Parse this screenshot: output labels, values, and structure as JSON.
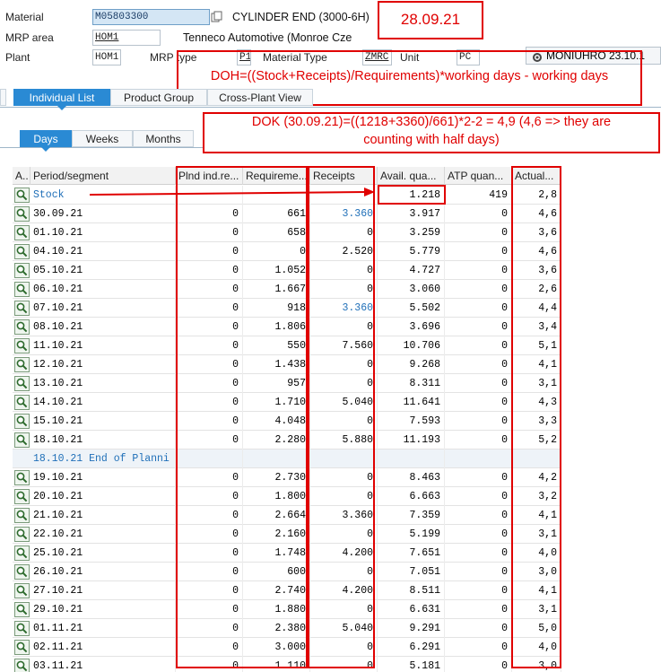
{
  "header": {
    "material_label": "Material",
    "material_value": "M05803300",
    "material_desc": "CYLINDER END (3000-6H)",
    "mrp_area_label": "MRP area",
    "mrp_area_value": "HOM1",
    "mrp_area_desc": "Tenneco Automotive (Monroe Cze",
    "plant_label": "Plant",
    "plant_value": "HOM1",
    "mrp_type_label": "MRP type",
    "mrp_type_value": "P1",
    "material_type_label": "Material Type",
    "material_type_value": "ZMRC",
    "unit_label": "Unit",
    "unit_value": "PC",
    "user_button": "MONIUHRO 23.10.1"
  },
  "annotations": {
    "date": "28.09.21",
    "doh_formula": "DOH=((Stock+Receipts)/Requirements)*working days - working days",
    "dok_line1": "DOK (30.09.21)=((1218+3360)/661)*2-2 = 4,9 (4,6 => they are",
    "dok_line2": "counting with half days)"
  },
  "tabs": {
    "individual_list": "Individual List",
    "product_group": "Product Group",
    "cross_plant": "Cross-Plant View",
    "days": "Days",
    "weeks": "Weeks",
    "months": "Months"
  },
  "grid": {
    "headers": [
      "A..",
      "Period/segment",
      "Plnd ind.re...",
      "Requireme...",
      "Receipts",
      "Avail. qua...",
      "ATP quan...",
      "Actual..."
    ],
    "rows": [
      {
        "period": "Stock",
        "plnd": "",
        "req": "",
        "rec": "",
        "avail": "1.218",
        "atp": "419",
        "actual": "2,8",
        "kind": "stock"
      },
      {
        "period": "30.09.21",
        "plnd": "0",
        "req": "661",
        "rec": "3.360",
        "avail": "3.917",
        "atp": "0",
        "actual": "4,6",
        "recblue": true
      },
      {
        "period": "01.10.21",
        "plnd": "0",
        "req": "658",
        "rec": "0",
        "avail": "3.259",
        "atp": "0",
        "actual": "3,6"
      },
      {
        "period": "04.10.21",
        "plnd": "0",
        "req": "0",
        "rec": "2.520",
        "avail": "5.779",
        "atp": "0",
        "actual": "4,6"
      },
      {
        "period": "05.10.21",
        "plnd": "0",
        "req": "1.052",
        "rec": "0",
        "avail": "4.727",
        "atp": "0",
        "actual": "3,6"
      },
      {
        "period": "06.10.21",
        "plnd": "0",
        "req": "1.667",
        "rec": "0",
        "avail": "3.060",
        "atp": "0",
        "actual": "2,6"
      },
      {
        "period": "07.10.21",
        "plnd": "0",
        "req": "918",
        "rec": "3.360",
        "avail": "5.502",
        "atp": "0",
        "actual": "4,4",
        "recblue": true
      },
      {
        "period": "08.10.21",
        "plnd": "0",
        "req": "1.806",
        "rec": "0",
        "avail": "3.696",
        "atp": "0",
        "actual": "3,4"
      },
      {
        "period": "11.10.21",
        "plnd": "0",
        "req": "550",
        "rec": "7.560",
        "avail": "10.706",
        "atp": "0",
        "actual": "5,1"
      },
      {
        "period": "12.10.21",
        "plnd": "0",
        "req": "1.438",
        "rec": "0",
        "avail": "9.268",
        "atp": "0",
        "actual": "4,1"
      },
      {
        "period": "13.10.21",
        "plnd": "0",
        "req": "957",
        "rec": "0",
        "avail": "8.311",
        "atp": "0",
        "actual": "3,1"
      },
      {
        "period": "14.10.21",
        "plnd": "0",
        "req": "1.710",
        "rec": "5.040",
        "avail": "11.641",
        "atp": "0",
        "actual": "4,3"
      },
      {
        "period": "15.10.21",
        "plnd": "0",
        "req": "4.048",
        "rec": "0",
        "avail": "7.593",
        "atp": "0",
        "actual": "3,3"
      },
      {
        "period": "18.10.21",
        "plnd": "0",
        "req": "2.280",
        "rec": "5.880",
        "avail": "11.193",
        "atp": "0",
        "actual": "5,2"
      },
      {
        "period": "18.10.21 End of Planni",
        "plnd": "",
        "req": "",
        "rec": "",
        "avail": "",
        "atp": "",
        "actual": "",
        "kind": "end"
      },
      {
        "period": "19.10.21",
        "plnd": "0",
        "req": "2.730",
        "rec": "0",
        "avail": "8.463",
        "atp": "0",
        "actual": "4,2"
      },
      {
        "period": "20.10.21",
        "plnd": "0",
        "req": "1.800",
        "rec": "0",
        "avail": "6.663",
        "atp": "0",
        "actual": "3,2"
      },
      {
        "period": "21.10.21",
        "plnd": "0",
        "req": "2.664",
        "rec": "3.360",
        "avail": "7.359",
        "atp": "0",
        "actual": "4,1"
      },
      {
        "period": "22.10.21",
        "plnd": "0",
        "req": "2.160",
        "rec": "0",
        "avail": "5.199",
        "atp": "0",
        "actual": "3,1"
      },
      {
        "period": "25.10.21",
        "plnd": "0",
        "req": "1.748",
        "rec": "4.200",
        "avail": "7.651",
        "atp": "0",
        "actual": "4,0"
      },
      {
        "period": "26.10.21",
        "plnd": "0",
        "req": "600",
        "rec": "0",
        "avail": "7.051",
        "atp": "0",
        "actual": "3,0"
      },
      {
        "period": "27.10.21",
        "plnd": "0",
        "req": "2.740",
        "rec": "4.200",
        "avail": "8.511",
        "atp": "0",
        "actual": "4,1"
      },
      {
        "period": "29.10.21",
        "plnd": "0",
        "req": "1.880",
        "rec": "0",
        "avail": "6.631",
        "atp": "0",
        "actual": "3,1"
      },
      {
        "period": "01.11.21",
        "plnd": "0",
        "req": "2.380",
        "rec": "5.040",
        "avail": "9.291",
        "atp": "0",
        "actual": "5,0"
      },
      {
        "period": "02.11.21",
        "plnd": "0",
        "req": "3.000",
        "rec": "0",
        "avail": "6.291",
        "atp": "0",
        "actual": "4,0"
      },
      {
        "period": "03.11.21",
        "plnd": "0",
        "req": "1.110",
        "rec": "0",
        "avail": "5.181",
        "atp": "0",
        "actual": "3,0"
      }
    ]
  },
  "colors": {
    "annotation_red": "#e00000",
    "active_tab": "#2a8ad4",
    "link_blue": "#1f6fb8"
  },
  "icons": {
    "row_icon": "magnifier-detail-icon",
    "selection_icon": "copy-icon",
    "user_icon": "gear-icon"
  }
}
